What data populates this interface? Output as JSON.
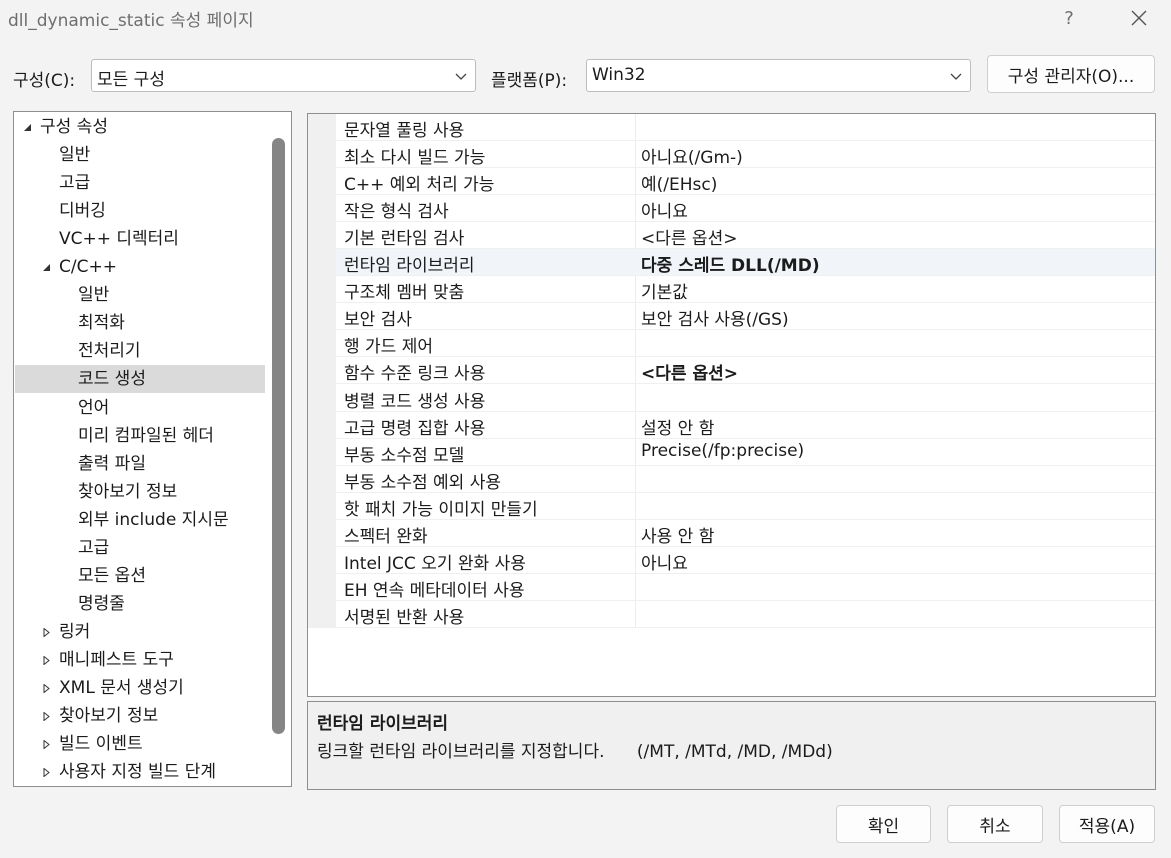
{
  "window": {
    "title": "dll_dynamic_static 속성 페이지",
    "help_label": "?"
  },
  "toolbar": {
    "config_label": "구성(C):",
    "config_value": "모든 구성",
    "platform_label": "플랫폼(P):",
    "platform_value": "Win32",
    "config_manager_label": "구성 관리자(O)..."
  },
  "tree": {
    "items": [
      {
        "label": "구성 속성",
        "level": 0,
        "expander": "expanded",
        "selected": false
      },
      {
        "label": "일반",
        "level": 1,
        "expander": "none",
        "selected": false
      },
      {
        "label": "고급",
        "level": 1,
        "expander": "none",
        "selected": false
      },
      {
        "label": "디버깅",
        "level": 1,
        "expander": "none",
        "selected": false
      },
      {
        "label": "VC++ 디렉터리",
        "level": 1,
        "expander": "none",
        "selected": false
      },
      {
        "label": "C/C++",
        "level": 1,
        "expander": "expanded",
        "selected": false
      },
      {
        "label": "일반",
        "level": 2,
        "expander": "none",
        "selected": false
      },
      {
        "label": "최적화",
        "level": 2,
        "expander": "none",
        "selected": false
      },
      {
        "label": "전처리기",
        "level": 2,
        "expander": "none",
        "selected": false
      },
      {
        "label": "코드 생성",
        "level": 2,
        "expander": "none",
        "selected": true
      },
      {
        "label": "언어",
        "level": 2,
        "expander": "none",
        "selected": false
      },
      {
        "label": "미리 컴파일된 헤더",
        "level": 2,
        "expander": "none",
        "selected": false
      },
      {
        "label": "출력 파일",
        "level": 2,
        "expander": "none",
        "selected": false
      },
      {
        "label": "찾아보기 정보",
        "level": 2,
        "expander": "none",
        "selected": false
      },
      {
        "label": "외부 include 지시문",
        "level": 2,
        "expander": "none",
        "selected": false
      },
      {
        "label": "고급",
        "level": 2,
        "expander": "none",
        "selected": false
      },
      {
        "label": "모든 옵션",
        "level": 2,
        "expander": "none",
        "selected": false
      },
      {
        "label": "명령줄",
        "level": 2,
        "expander": "none",
        "selected": false
      },
      {
        "label": "링커",
        "level": 1,
        "expander": "collapsed",
        "selected": false
      },
      {
        "label": "매니페스트 도구",
        "level": 1,
        "expander": "collapsed",
        "selected": false
      },
      {
        "label": "XML 문서 생성기",
        "level": 1,
        "expander": "collapsed",
        "selected": false
      },
      {
        "label": "찾아보기 정보",
        "level": 1,
        "expander": "collapsed",
        "selected": false
      },
      {
        "label": "빌드 이벤트",
        "level": 1,
        "expander": "collapsed",
        "selected": false
      },
      {
        "label": "사용자 지정 빌드 단계",
        "level": 1,
        "expander": "collapsed",
        "selected": false
      }
    ]
  },
  "properties": {
    "rows": [
      {
        "name": "문자열 풀링 사용",
        "value": "",
        "bold": false,
        "selected": false
      },
      {
        "name": "최소 다시 빌드 가능",
        "value": "아니요(/Gm-)",
        "bold": false,
        "selected": false
      },
      {
        "name": "C++ 예외 처리 가능",
        "value": "예(/EHsc)",
        "bold": false,
        "selected": false
      },
      {
        "name": "작은 형식 검사",
        "value": "아니요",
        "bold": false,
        "selected": false
      },
      {
        "name": "기본 런타임 검사",
        "value": "<다른 옵션>",
        "bold": false,
        "selected": false
      },
      {
        "name": "런타임 라이브러리",
        "value": "다중 스레드 DLL(/MD)",
        "bold": true,
        "selected": true
      },
      {
        "name": "구조체 멤버 맞춤",
        "value": "기본값",
        "bold": false,
        "selected": false
      },
      {
        "name": "보안 검사",
        "value": "보안 검사 사용(/GS)",
        "bold": false,
        "selected": false
      },
      {
        "name": "행 가드 제어",
        "value": "",
        "bold": false,
        "selected": false
      },
      {
        "name": "함수 수준 링크 사용",
        "value": "<다른 옵션>",
        "bold": true,
        "selected": false
      },
      {
        "name": "병렬 코드 생성 사용",
        "value": "",
        "bold": false,
        "selected": false
      },
      {
        "name": "고급 명령 집합 사용",
        "value": "설정 안 함",
        "bold": false,
        "selected": false
      },
      {
        "name": "부동 소수점 모델",
        "value": "Precise(/fp:precise)",
        "bold": false,
        "selected": false
      },
      {
        "name": "부동 소수점 예외 사용",
        "value": "",
        "bold": false,
        "selected": false
      },
      {
        "name": "핫 패치 가능 이미지 만들기",
        "value": "",
        "bold": false,
        "selected": false
      },
      {
        "name": "스펙터 완화",
        "value": "사용 안 함",
        "bold": false,
        "selected": false
      },
      {
        "name": "Intel JCC 오기 완화 사용",
        "value": "아니요",
        "bold": false,
        "selected": false
      },
      {
        "name": "EH 연속 메타데이터 사용",
        "value": "",
        "bold": false,
        "selected": false
      },
      {
        "name": "서명된 반환 사용",
        "value": "",
        "bold": false,
        "selected": false
      }
    ]
  },
  "description": {
    "title": "런타임 라이브러리",
    "text": "링크할 런타임 라이브러리를 지정합니다.      (/MT, /MTd, /MD, /MDd)"
  },
  "buttons": {
    "ok": "확인",
    "cancel": "취소",
    "apply": "적용(A)"
  }
}
